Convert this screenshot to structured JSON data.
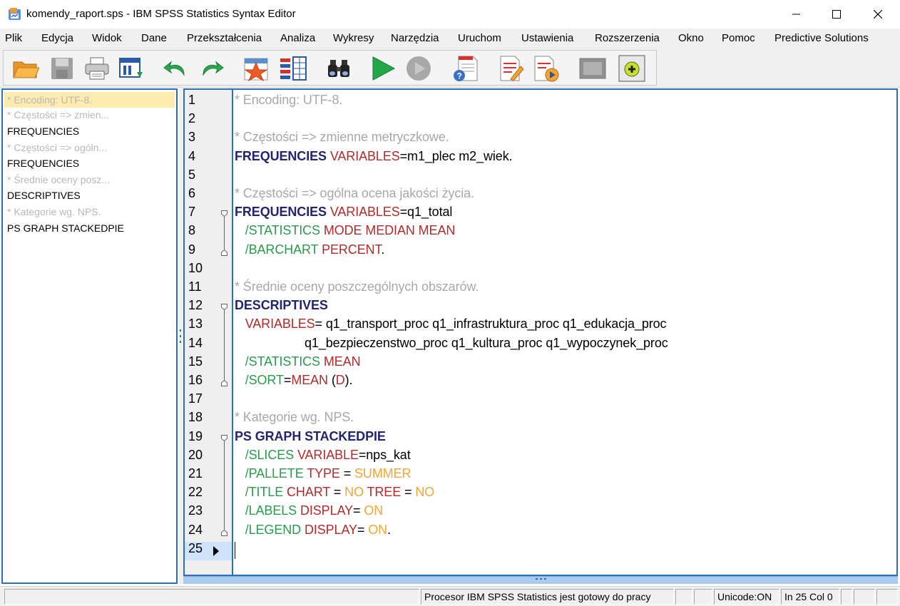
{
  "window": {
    "title": "komendy_raport.sps - IBM SPSS Statistics Syntax Editor",
    "icons": {
      "app": "spss-app-icon",
      "minimize": "minimize-icon",
      "maximize": "maximize-icon",
      "close": "close-icon"
    }
  },
  "menu": {
    "items": [
      "Plik",
      "Edycja",
      "Widok",
      "Dane",
      "Przekształcenia",
      "Analiza",
      "Wykresy",
      "Narzędzia",
      "Uruchom",
      "Ustawienia",
      "Rozszerzenia",
      "Okno",
      "Pomoc",
      "Predictive Solutions"
    ]
  },
  "toolbar": {
    "buttons": [
      "open-folder-icon",
      "save-icon",
      "print-icon",
      "recall-dialog-icon",
      "undo-icon",
      "redo-icon",
      "goto-case-icon",
      "variables-icon",
      "find-icon",
      "run-icon",
      "stop-icon",
      "syntax-help-icon",
      "annotation-icon",
      "run-to-end-icon",
      "designate-window-icon",
      "extension-icon"
    ]
  },
  "navigator": {
    "items": [
      {
        "text": "* Encoding: UTF-8.",
        "kind": "comment",
        "selected": true
      },
      {
        "text": "* Częstości => zmien...",
        "kind": "comment"
      },
      {
        "text": "FREQUENCIES",
        "kind": "cmd"
      },
      {
        "text": "* Częstości => ogóln...",
        "kind": "comment"
      },
      {
        "text": "FREQUENCIES",
        "kind": "cmd"
      },
      {
        "text": "* Średnie oceny posz...",
        "kind": "comment"
      },
      {
        "text": "DESCRIPTIVES",
        "kind": "cmd"
      },
      {
        "text": "* Kategorie wg. NPS.",
        "kind": "comment"
      },
      {
        "text": "PS GRAPH STACKEDPIE",
        "kind": "cmd"
      }
    ]
  },
  "editor": {
    "line_numbers": [
      "1",
      "2",
      "3",
      "4",
      "5",
      "6",
      "7",
      "8",
      "9",
      "10",
      "11",
      "12",
      "13",
      "14",
      "15",
      "16",
      "17",
      "18",
      "19",
      "20",
      "21",
      "22",
      "23",
      "24",
      "25"
    ],
    "current_line": 25,
    "lines": [
      [
        [
          "comment",
          "* Encoding: UTF-8."
        ]
      ],
      [],
      [
        [
          "comment",
          "* Częstości => zmienne metryczkowe."
        ]
      ],
      [
        [
          "cmd",
          "FREQUENCIES"
        ],
        [
          "txt",
          " "
        ],
        [
          "kw",
          "VARIABLES"
        ],
        [
          "txt",
          "=m1_plec m2_wiek."
        ]
      ],
      [],
      [
        [
          "comment",
          "* Częstości => ogólna ocena jakości życia."
        ]
      ],
      [
        [
          "cmd",
          "FREQUENCIES"
        ],
        [
          "txt",
          " "
        ],
        [
          "kw",
          "VARIABLES"
        ],
        [
          "txt",
          "=q1_total"
        ]
      ],
      [
        [
          "txt",
          "   "
        ],
        [
          "sub",
          "/STATISTICS"
        ],
        [
          "txt",
          " "
        ],
        [
          "kw",
          "MODE MEDIAN MEAN"
        ]
      ],
      [
        [
          "txt",
          "   "
        ],
        [
          "sub",
          "/BARCHART"
        ],
        [
          "txt",
          " "
        ],
        [
          "kw",
          "PERCENT"
        ],
        [
          "txt",
          "."
        ]
      ],
      [],
      [
        [
          "comment",
          "* Średnie oceny poszczególnych obszarów."
        ]
      ],
      [
        [
          "cmd",
          "DESCRIPTIVES"
        ]
      ],
      [
        [
          "txt",
          "   "
        ],
        [
          "kw",
          "VARIABLES"
        ],
        [
          "txt",
          "= q1_transport_proc q1_infrastruktura_proc q1_edukacja_proc"
        ]
      ],
      [
        [
          "txt",
          "                    q1_bezpieczenstwo_proc q1_kultura_proc q1_wypoczynek_proc"
        ]
      ],
      [
        [
          "txt",
          "   "
        ],
        [
          "sub",
          "/STATISTICS"
        ],
        [
          "txt",
          " "
        ],
        [
          "kw",
          "MEAN"
        ]
      ],
      [
        [
          "txt",
          "   "
        ],
        [
          "sub",
          "/SORT"
        ],
        [
          "txt",
          "="
        ],
        [
          "kw",
          "MEAN"
        ],
        [
          "txt",
          " ("
        ],
        [
          "kw",
          "D"
        ],
        [
          "txt",
          ")."
        ]
      ],
      [],
      [
        [
          "comment",
          "* Kategorie wg. NPS."
        ]
      ],
      [
        [
          "cmd",
          "PS GRAPH STACKEDPIE"
        ]
      ],
      [
        [
          "txt",
          "   "
        ],
        [
          "sub",
          "/SLICES"
        ],
        [
          "txt",
          " "
        ],
        [
          "kw",
          "VARIABLE"
        ],
        [
          "txt",
          "=nps_kat"
        ]
      ],
      [
        [
          "txt",
          "   "
        ],
        [
          "sub",
          "/PALLETE"
        ],
        [
          "txt",
          " "
        ],
        [
          "kw",
          "TYPE"
        ],
        [
          "txt",
          " = "
        ],
        [
          "val",
          "SUMMER"
        ]
      ],
      [
        [
          "txt",
          "   "
        ],
        [
          "sub",
          "/TITLE"
        ],
        [
          "txt",
          " "
        ],
        [
          "kw",
          "CHART"
        ],
        [
          "txt",
          " = "
        ],
        [
          "val",
          "NO"
        ],
        [
          "txt",
          " "
        ],
        [
          "kw",
          "TREE"
        ],
        [
          "txt",
          " = "
        ],
        [
          "val",
          "NO"
        ]
      ],
      [
        [
          "txt",
          "   "
        ],
        [
          "sub",
          "/LABELS"
        ],
        [
          "txt",
          " "
        ],
        [
          "kw",
          "DISPLAY"
        ],
        [
          "txt",
          "= "
        ],
        [
          "val",
          "ON"
        ]
      ],
      [
        [
          "txt",
          "   "
        ],
        [
          "sub",
          "/LEGEND"
        ],
        [
          "txt",
          " "
        ],
        [
          "kw",
          "DISPLAY"
        ],
        [
          "txt",
          "= "
        ],
        [
          "val",
          "ON"
        ],
        [
          "txt",
          "."
        ]
      ],
      []
    ],
    "colors": {
      "comment": "#a8a8a8",
      "cmd": "#24246e",
      "kw": "#b42a2a",
      "sub": "#2a9a4e",
      "val": "#f3a531",
      "accent": "#2b6fbf"
    }
  },
  "status": {
    "processor": "Procesor IBM SPSS Statistics  jest gotowy do pracy",
    "unicode": "Unicode:ON",
    "position": "In 25 Col 0"
  }
}
